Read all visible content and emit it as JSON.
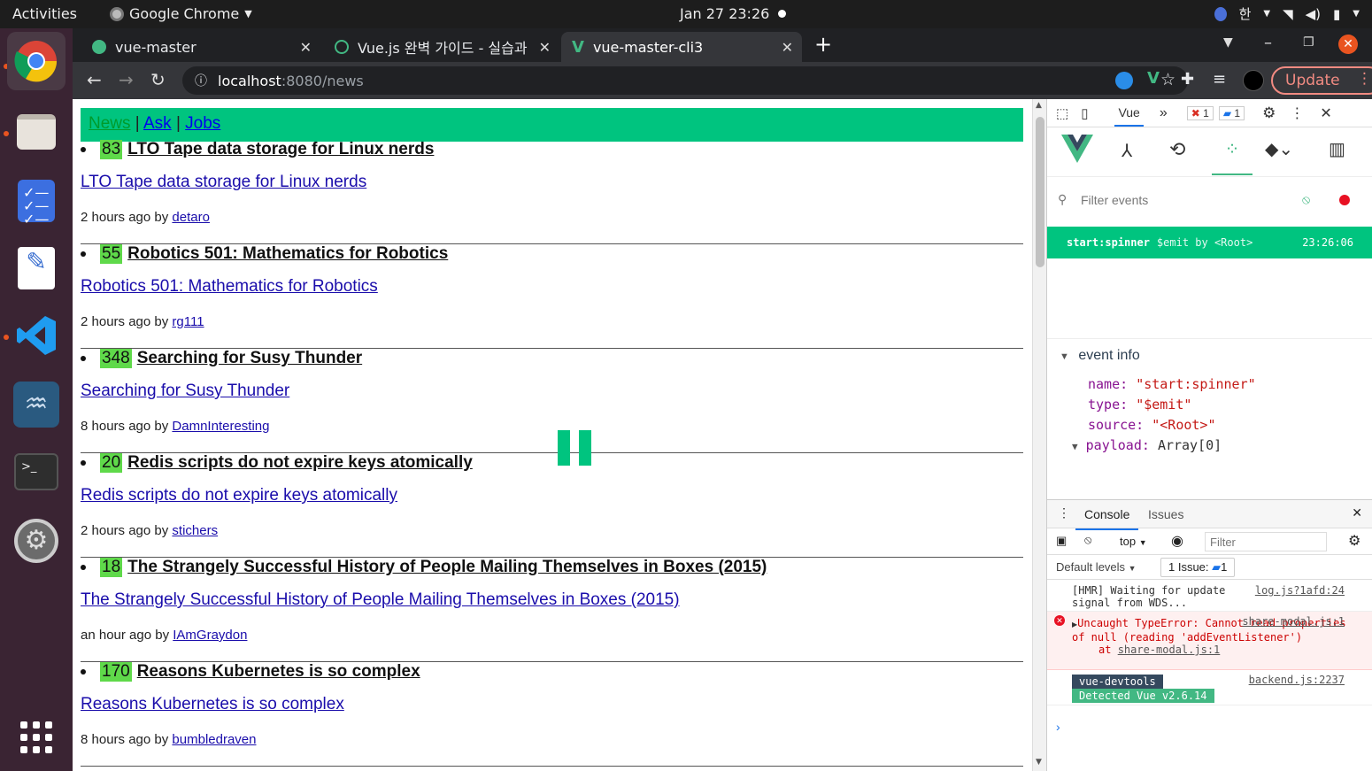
{
  "system": {
    "activities": "Activities",
    "app_name": "Google Chrome",
    "clock": "Jan 27  23:26",
    "input_method": "한"
  },
  "browser": {
    "tabs": [
      {
        "label": "vue-master"
      },
      {
        "label": "Vue.js 완벽 가이드 - 실습과"
      },
      {
        "label": "vue-master-cli3"
      }
    ],
    "url_host": "localhost",
    "url_path": ":8080/news",
    "update_label": "Update"
  },
  "page": {
    "nav": {
      "news": "News",
      "sep1": "|",
      "ask": "Ask",
      "sep2": "|",
      "jobs": "Jobs"
    },
    "items": [
      {
        "points": "83",
        "title": "LTO Tape data storage for Linux nerds",
        "link": "LTO Tape data storage for Linux nerds",
        "time": "2 hours ago by",
        "user": "detaro"
      },
      {
        "points": "55",
        "title": "Robotics 501: Mathematics for Robotics",
        "link": "Robotics 501: Mathematics for Robotics",
        "time": "2 hours ago by",
        "user": "rg111"
      },
      {
        "points": "348",
        "title": "Searching for Susy Thunder",
        "link": "Searching for Susy Thunder",
        "time": "8 hours ago by",
        "user": "DamnInteresting"
      },
      {
        "points": "20",
        "title": "Redis scripts do not expire keys atomically",
        "link": "Redis scripts do not expire keys atomically",
        "time": "2 hours ago by",
        "user": "stichers"
      },
      {
        "points": "18",
        "title": "The Strangely Successful History of People Mailing Themselves in Boxes (2015)",
        "link": "The Strangely Successful History of People Mailing Themselves in Boxes (2015)",
        "time": "an hour ago by",
        "user": "IAmGraydon"
      },
      {
        "points": "170",
        "title": "Reasons Kubernetes is so complex",
        "link": "Reasons Kubernetes is so complex",
        "time": "8 hours ago by",
        "user": "bumbledraven"
      }
    ]
  },
  "devtools": {
    "tab_vue": "Vue",
    "error_count": "1",
    "message_count": "1",
    "filter_placeholder": "Filter events",
    "event": {
      "name": "start:spinner",
      "kind": "$emit by <Root>",
      "time": "23:26:06"
    },
    "info_header": "event info",
    "info": {
      "name_key": "name:",
      "name_val": "\"start:spinner\"",
      "type_key": "type:",
      "type_val": "\"$emit\"",
      "source_key": "source:",
      "source_val": "\"<Root>\"",
      "payload_key": "payload:",
      "payload_val": "Array[0]"
    },
    "console": {
      "tab_console": "Console",
      "tab_issues": "Issues",
      "context": "top",
      "filter_placeholder": "Filter",
      "levels": "Default levels",
      "issues_badge": "1 Issue:",
      "issues_count": "1",
      "log1_text": "[HMR] Waiting for update signal from WDS...",
      "log1_src": "log.js?1afd:24",
      "err_text": "Uncaught TypeError: Cannot read properties of null (reading 'addEventListener')",
      "err_at": "at",
      "err_src": "share-modal.js:1",
      "dev_badge": "vue-devtools",
      "dev_src": "backend.js:2237",
      "dev_detected": "Detected Vue v2.6.14"
    }
  }
}
